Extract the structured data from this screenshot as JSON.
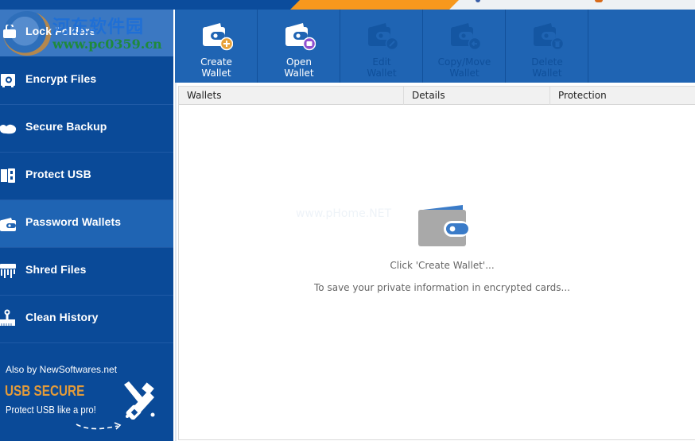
{
  "colors": {
    "sidebar_bg": "#0a4a98",
    "sidebar_active": "#1f64b3",
    "toolbar_bg": "#1f64b3",
    "accent_orange": "#f7981d",
    "promo_brand": "#e39b3a",
    "wallet_gray": "#a9a9a9",
    "wallet_blue": "#3a7bc8"
  },
  "watermark": {
    "cn_text": "河东软件园",
    "url_text": "www.pc0359.cn",
    "ghost_text": "www.pHome.NET"
  },
  "sidebar": {
    "items": [
      {
        "label": "Lock Folders",
        "icon": "lock-folder-icon"
      },
      {
        "label": "Encrypt Files",
        "icon": "safe-icon"
      },
      {
        "label": "Secure Backup",
        "icon": "cloud-icon"
      },
      {
        "label": "Protect USB",
        "icon": "usb-icon"
      },
      {
        "label": "Password Wallets",
        "icon": "wallet-icon",
        "active": true
      },
      {
        "label": "Shred Files",
        "icon": "shredder-icon"
      },
      {
        "label": "Clean History",
        "icon": "brush-icon"
      }
    ],
    "promo": {
      "by": "Also by NewSoftwares.net",
      "brand": "USB SECURE",
      "tagline": "Protect USB like a pro!"
    }
  },
  "toolbar": {
    "buttons": [
      {
        "line1": "Create",
        "line2": "Wallet",
        "enabled": true,
        "badge": "plus"
      },
      {
        "line1": "Open",
        "line2": "Wallet",
        "enabled": true,
        "badge": "open"
      },
      {
        "line1": "Edit",
        "line2": "Wallet",
        "enabled": false,
        "badge": "edit"
      },
      {
        "line1": "Copy/Move",
        "line2": "Wallet",
        "enabled": false,
        "badge": "move"
      },
      {
        "line1": "Delete",
        "line2": "Wallet",
        "enabled": false,
        "badge": "delete"
      }
    ]
  },
  "list": {
    "columns": [
      "Wallets",
      "Details",
      "Protection"
    ],
    "empty_title": "Click 'Create Wallet'...",
    "empty_subtitle": "To save your private information in encrypted cards..."
  }
}
